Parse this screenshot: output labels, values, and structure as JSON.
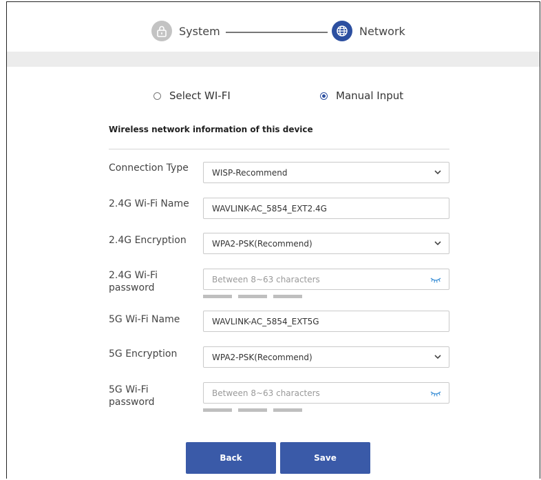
{
  "stepper": {
    "steps": [
      {
        "label": "System",
        "state": "inactive",
        "icon": "lock-icon"
      },
      {
        "label": "Network",
        "state": "active",
        "icon": "globe-icon"
      }
    ]
  },
  "mode": {
    "options": [
      {
        "label": "Select WI-FI",
        "checked": false
      },
      {
        "label": "Manual Input",
        "checked": true
      }
    ]
  },
  "section_title": "Wireless network information of this device",
  "fields": {
    "connection_type": {
      "label": "Connection Type",
      "value": "WISP-Recommend"
    },
    "wifi24_name": {
      "label": "2.4G Wi-Fi Name",
      "value": "WAVLINK-AC_5854_EXT2.4G"
    },
    "enc24": {
      "label": "2.4G Encryption",
      "value": "WPA2-PSK(Recommend)"
    },
    "pass24": {
      "label": "2.4G Wi-Fi password",
      "placeholder": "Between 8~63 characters"
    },
    "wifi5_name": {
      "label": "5G Wi-Fi Name",
      "value": "WAVLINK-AC_5854_EXT5G"
    },
    "enc5": {
      "label": "5G Encryption",
      "value": "WPA2-PSK(Recommend)"
    },
    "pass5": {
      "label": "5G Wi-Fi password",
      "placeholder": "Between 8~63 characters"
    }
  },
  "buttons": {
    "back": "Back",
    "save": "Save"
  },
  "colors": {
    "accent": "#3a5aa8",
    "inactive_step": "#c3c3c3",
    "stripe": "#ececec"
  }
}
